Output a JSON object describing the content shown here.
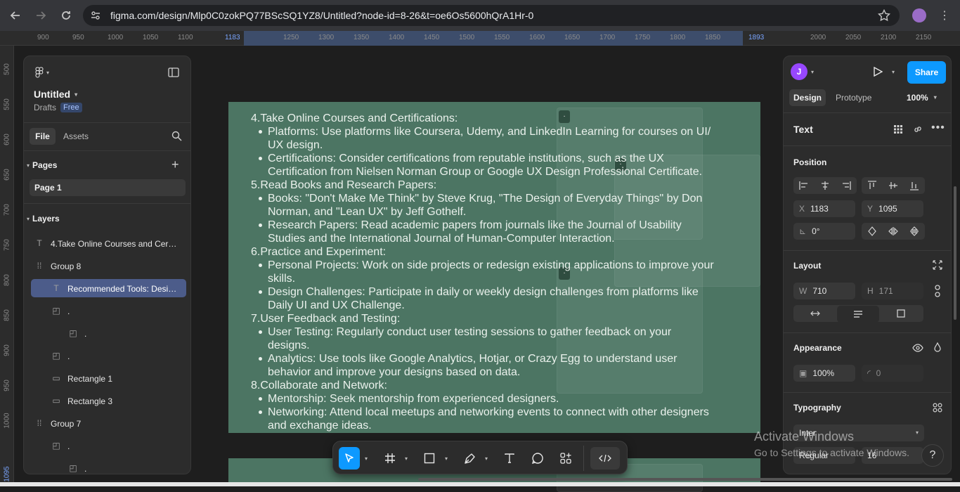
{
  "browser": {
    "url": "figma.com/design/Mlp0C0zokPQ77BScSQ1YZ8/Untitled?node-id=8-26&t=oe6Os5600hQrA1Hr-0"
  },
  "ruler": {
    "h_ticks": [
      "900",
      "950",
      "1000",
      "1050",
      "1100",
      "1183",
      "1250",
      "1300",
      "1350",
      "1400",
      "1450",
      "1500",
      "1550",
      "1600",
      "1650",
      "1700",
      "1750",
      "1800",
      "1850",
      "1893",
      "2000",
      "2050",
      "2100",
      "2150"
    ],
    "v_ticks": [
      "500",
      "550",
      "600",
      "650",
      "700",
      "750",
      "800",
      "850",
      "900",
      "950",
      "1000",
      "1095"
    ]
  },
  "left_panel": {
    "file_name": "Untitled",
    "location": "Drafts",
    "plan_badge": "Free",
    "tabs": [
      "File",
      "Assets"
    ],
    "pages_title": "Pages",
    "pages": [
      "Page 1"
    ],
    "layers_title": "Layers",
    "layers": [
      {
        "icon": "T",
        "label": "4.Take Online Courses and Certific...",
        "selected": false
      },
      {
        "icon": "group",
        "label": "Group 8",
        "selected": false
      },
      {
        "icon": "T",
        "label": "Recommended Tools: Design ...",
        "selected": true
      },
      {
        "icon": "frame",
        "label": ".",
        "selected": false
      },
      {
        "icon": "frame",
        "label": ".",
        "selected": false
      },
      {
        "icon": "frame",
        "label": ".",
        "selected": false
      },
      {
        "icon": "rect",
        "label": "Rectangle 1",
        "selected": false
      },
      {
        "icon": "rect",
        "label": "Rectangle 3",
        "selected": false
      },
      {
        "icon": "group",
        "label": "Group 7",
        "selected": false
      },
      {
        "icon": "frame",
        "label": ".",
        "selected": false
      },
      {
        "icon": "frame",
        "label": ".",
        "selected": false
      }
    ]
  },
  "canvas": {
    "text_lines": [
      {
        "kind": "h",
        "text": "4.Take Online Courses and Certifications:"
      },
      {
        "kind": "b",
        "text": "Platforms: Use platforms like Coursera, Udemy, and LinkedIn Learning for courses on UI/"
      },
      {
        "kind": "c",
        "text": "UX design."
      },
      {
        "kind": "b",
        "text": "Certifications: Consider certifications from reputable institutions, such as the UX"
      },
      {
        "kind": "c",
        "text": "Certification from Nielsen Norman Group or Google UX Design Professional Certificate."
      },
      {
        "kind": "h",
        "text": "5.Read Books and Research Papers:"
      },
      {
        "kind": "b",
        "text": "Books: \"Don't Make Me Think\" by Steve Krug, \"The Design of Everyday Things\" by Don"
      },
      {
        "kind": "c",
        "text": "Norman, and \"Lean UX\" by Jeff Gothelf."
      },
      {
        "kind": "b",
        "text": "Research Papers: Read academic papers from journals like the Journal of Usability"
      },
      {
        "kind": "c",
        "text": "Studies and the International Journal of Human-Computer Interaction."
      },
      {
        "kind": "h",
        "text": "6.Practice and Experiment:"
      },
      {
        "kind": "b",
        "text": "Personal Projects: Work on side projects or redesign existing applications to improve your"
      },
      {
        "kind": "c",
        "text": "skills."
      },
      {
        "kind": "b",
        "text": "Design Challenges: Participate in daily or weekly design challenges from platforms like"
      },
      {
        "kind": "c",
        "text": "Daily UI and UX Challenge."
      },
      {
        "kind": "h",
        "text": "7.User Feedback and Testing:"
      },
      {
        "kind": "b",
        "text": "User Testing: Regularly conduct user testing sessions to gather feedback on your"
      },
      {
        "kind": "c",
        "text": "designs."
      },
      {
        "kind": "b",
        "text": "Analytics: Use tools like Google Analytics, Hotjar, or Crazy Egg to understand user"
      },
      {
        "kind": "c",
        "text": "behavior and improve your designs based on data."
      },
      {
        "kind": "h",
        "text": "8.Collaborate and Network:"
      },
      {
        "kind": "b",
        "text": "Mentorship: Seek mentorship from experienced designers."
      },
      {
        "kind": "b",
        "text": "Networking: Attend local meetups and networking events to connect with other designers"
      },
      {
        "kind": "c",
        "text": "and exchange ideas."
      }
    ],
    "chip_label": "."
  },
  "right_panel": {
    "avatar_initial": "J",
    "share_label": "Share",
    "tabs": [
      "Design",
      "Prototype"
    ],
    "zoom": "100%",
    "selection_type": "Text",
    "position_title": "Position",
    "x_label": "X",
    "x_value": "1183",
    "y_label": "Y",
    "y_value": "1095",
    "rotation": "0°",
    "layout_title": "Layout",
    "w_label": "W",
    "w_value": "710",
    "h_label": "H",
    "h_value": "171",
    "appearance_title": "Appearance",
    "opacity": "100%",
    "radius": "0",
    "typography_title": "Typography",
    "font_family": "Inter",
    "font_weight": "Regular",
    "font_size": "16"
  },
  "overlay": {
    "activate_title": "Activate Windows",
    "activate_sub": "Go to Settings to activate Windows.",
    "help": "?"
  },
  "colors": {
    "frame_fill": "#4c7563",
    "accent": "#0d99ff",
    "selection": "#4c5c8a",
    "avatar": "#9747ff"
  }
}
